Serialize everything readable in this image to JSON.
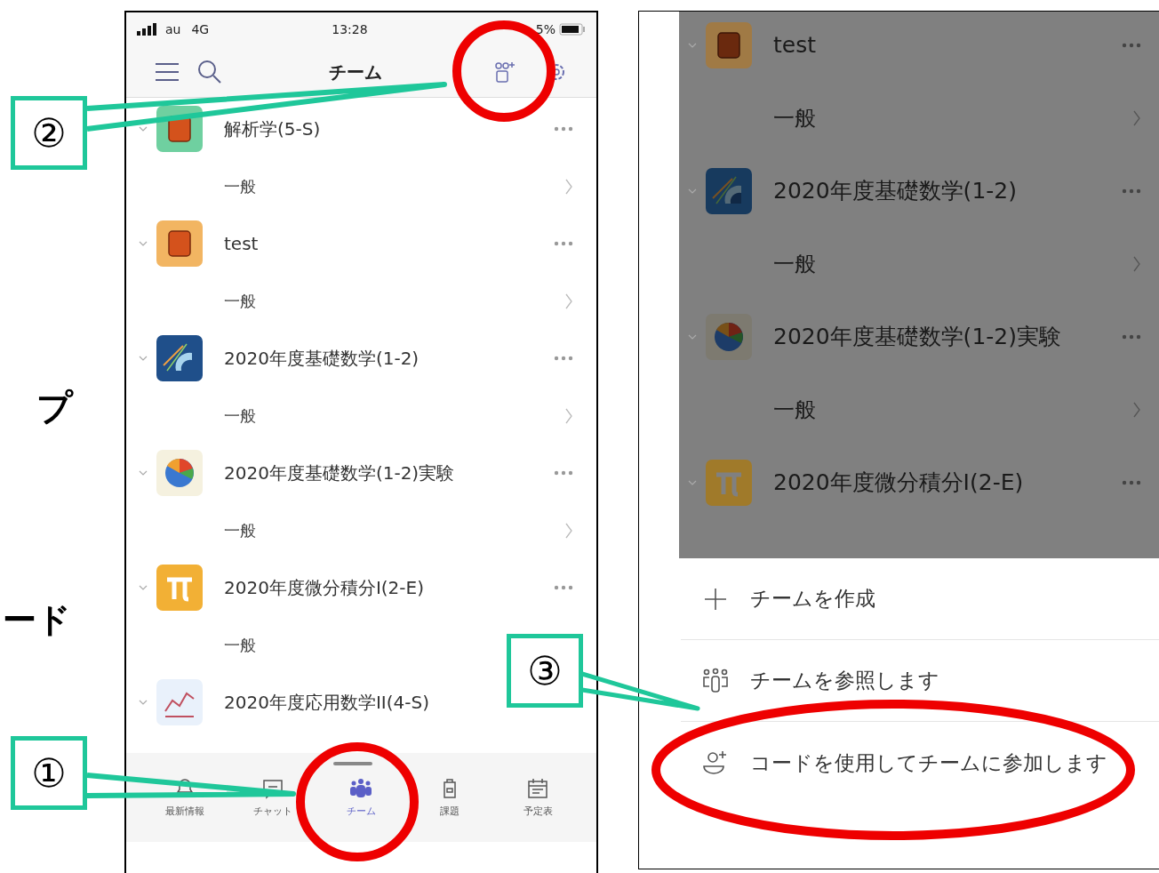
{
  "margin_text": [
    {
      "text": "プ"
    },
    {
      "text": "ード"
    }
  ],
  "left_phone": {
    "status_bar": {
      "carrier": "au",
      "network": "4G",
      "time": "13:28",
      "battery": "5%"
    },
    "header": {
      "title": "チーム"
    },
    "teams": [
      {
        "name": "解析学(5-S)",
        "kind": "block",
        "color": "#6fd0a0",
        "expanded": true,
        "channels": [
          {
            "name": "一般"
          }
        ]
      },
      {
        "name": "test",
        "kind": "block",
        "color": "#f2b562",
        "expanded": true,
        "channels": [
          {
            "name": "一般"
          }
        ]
      },
      {
        "name": "2020年度基礎数学(1-2)",
        "kind": "compass",
        "color": "#1f4f8a",
        "expanded": true,
        "channels": [
          {
            "name": "一般"
          }
        ]
      },
      {
        "name": "2020年度基礎数学(1-2)実験",
        "kind": "pie",
        "color": "#f5f1df",
        "expanded": true,
        "channels": [
          {
            "name": "一般"
          }
        ]
      },
      {
        "name": "2020年度微分積分I(2-E)",
        "kind": "pi",
        "color": "#f2b035",
        "expanded": true,
        "channels": [
          {
            "name": "一般"
          }
        ]
      },
      {
        "name": "2020年度応用数学II(4-S)",
        "kind": "chart",
        "color": "#e9f1fb",
        "expanded": true
      }
    ],
    "tab_bar": [
      {
        "label": "最新情報",
        "kind": "bell",
        "selected": false
      },
      {
        "label": "チャット",
        "kind": "chat",
        "selected": false
      },
      {
        "label": "チーム",
        "kind": "teams",
        "selected": true
      },
      {
        "label": "課題",
        "kind": "bag",
        "selected": false
      },
      {
        "label": "予定表",
        "kind": "calendar",
        "selected": false
      }
    ]
  },
  "right_phone": {
    "teams": [
      {
        "name": "test",
        "kind": "block",
        "color": "#a07a45",
        "expanded": true,
        "channels": [
          {
            "name": "一般"
          }
        ]
      },
      {
        "name": "2020年度基礎数学(1-2)",
        "kind": "compass",
        "color": "#173a5e",
        "expanded": true,
        "channels": [
          {
            "name": "一般"
          }
        ]
      },
      {
        "name": "2020年度基礎数学(1-2)実験",
        "kind": "pie",
        "color": "#7d7a70",
        "expanded": true,
        "channels": [
          {
            "name": "一般"
          }
        ]
      },
      {
        "name": "2020年度微分積分I(2-E)",
        "kind": "pi",
        "color": "#a07a2a",
        "expanded": true
      }
    ],
    "sheet": [
      {
        "label": "チームを作成",
        "kind": "plus"
      },
      {
        "label": "チームを参照します",
        "kind": "people"
      },
      {
        "label": "コードを使用してチームに参加します",
        "kind": "person-add"
      }
    ]
  },
  "markers": [
    {
      "number": "②"
    },
    {
      "number": "③"
    },
    {
      "number": "①"
    }
  ]
}
